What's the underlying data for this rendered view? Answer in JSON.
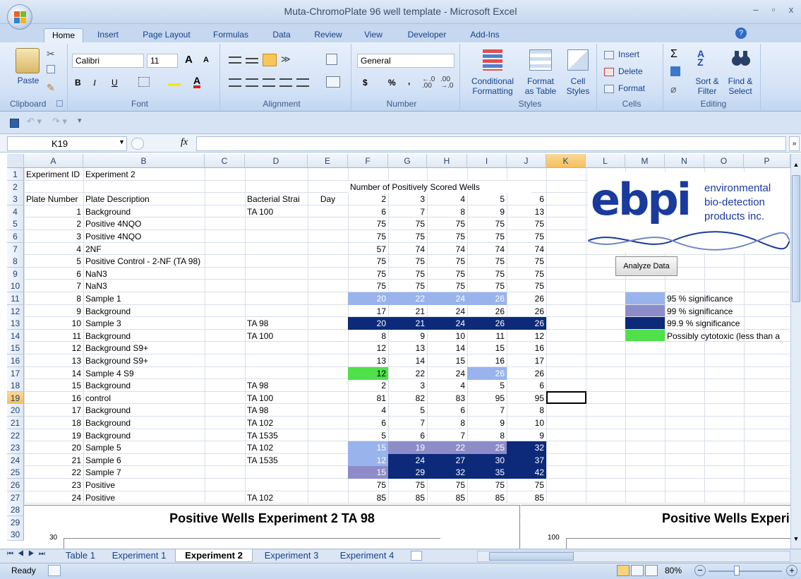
{
  "window": {
    "title": "Muta-ChromoPlate 96 well template - Microsoft Excel",
    "min": "–",
    "restore": "▫",
    "close": "x"
  },
  "tabs": [
    "Home",
    "Insert",
    "Page Layout",
    "Formulas",
    "Data",
    "Review",
    "View",
    "Developer",
    "Add-Ins"
  ],
  "ribbon": {
    "clipboard": {
      "paste": "Paste",
      "label": "Clipboard"
    },
    "font": {
      "name": "Calibri",
      "size": "11",
      "bold": "B",
      "italic": "I",
      "underline": "U",
      "grow": "A",
      "shrink": "A",
      "label": "Font"
    },
    "alignment": {
      "label": "Alignment"
    },
    "number": {
      "format": "General",
      "currency": "$",
      "percent": "%",
      "comma": ",",
      "label": "Number"
    },
    "styles": {
      "cond": "Conditional",
      "cond2": "Formatting",
      "fmt_table": "Format",
      "fmt_table2": "as Table",
      "cell_styles": "Cell",
      "cell_styles2": "Styles",
      "label": "Styles"
    },
    "cells": {
      "insert": "Insert",
      "delete": "Delete",
      "format": "Format",
      "label": "Cells"
    },
    "editing": {
      "sum": "Σ",
      "sort": "Sort &",
      "sort2": "Filter",
      "find": "Find &",
      "find2": "Select",
      "label": "Editing"
    }
  },
  "formula_bar": {
    "name_box": "K19",
    "fx": "fx",
    "value": ""
  },
  "columns": [
    "A",
    "B",
    "C",
    "D",
    "E",
    "F",
    "G",
    "H",
    "I",
    "J",
    "K",
    "L",
    "M",
    "N",
    "O",
    "P"
  ],
  "rows": [
    {
      "n": "1",
      "a": "Experiment ID",
      "b": "Experiment 2",
      "d": "",
      "e": "",
      "v": [
        "",
        "",
        "",
        "",
        ""
      ]
    },
    {
      "n": "2",
      "a": "",
      "b": "",
      "d": "",
      "e": "",
      "v": [
        "",
        "",
        "",
        "",
        ""
      ]
    },
    {
      "n": "3",
      "a": "Plate Number",
      "b": "Plate Description",
      "d": "Bacterial Strai",
      "e": "Day",
      "v": [
        "2",
        "3",
        "4",
        "5",
        "6"
      ]
    },
    {
      "n": "4",
      "a": "1",
      "b": "Background",
      "d": "TA 100",
      "e": "",
      "v": [
        "6",
        "7",
        "8",
        "9",
        "13"
      ]
    },
    {
      "n": "5",
      "a": "2",
      "b": "Positive 4NQO",
      "d": "",
      "e": "",
      "v": [
        "75",
        "75",
        "75",
        "75",
        "75"
      ]
    },
    {
      "n": "6",
      "a": "3",
      "b": "Positive 4NQO",
      "d": "",
      "e": "",
      "v": [
        "75",
        "75",
        "75",
        "75",
        "75"
      ]
    },
    {
      "n": "7",
      "a": "4",
      "b": "2NF",
      "d": "",
      "e": "",
      "v": [
        "57",
        "74",
        "74",
        "74",
        "74"
      ]
    },
    {
      "n": "8",
      "a": "5",
      "b": "Positive Control - 2-NF (TA 98)",
      "d": "",
      "e": "",
      "v": [
        "75",
        "75",
        "75",
        "75",
        "75"
      ]
    },
    {
      "n": "9",
      "a": "6",
      "b": "NaN3",
      "d": "",
      "e": "",
      "v": [
        "75",
        "75",
        "75",
        "75",
        "75"
      ]
    },
    {
      "n": "10",
      "a": "7",
      "b": "NaN3",
      "d": "",
      "e": "",
      "v": [
        "75",
        "75",
        "75",
        "75",
        "75"
      ]
    },
    {
      "n": "11",
      "a": "8",
      "b": "Sample 1",
      "d": "",
      "e": "",
      "v": [
        "20",
        "22",
        "24",
        "26",
        "26"
      ],
      "c": [
        "s95",
        "s95",
        "s95",
        "s95",
        ""
      ]
    },
    {
      "n": "12",
      "a": "9",
      "b": "Background",
      "d": "",
      "e": "",
      "v": [
        "17",
        "21",
        "24",
        "26",
        "26"
      ]
    },
    {
      "n": "13",
      "a": "10",
      "b": "Sample 3",
      "d": "TA 98",
      "e": "",
      "v": [
        "20",
        "21",
        "24",
        "26",
        "26"
      ],
      "c": [
        "s999",
        "s999",
        "s999",
        "s999",
        "s999"
      ]
    },
    {
      "n": "14",
      "a": "11",
      "b": "Background",
      "d": "TA 100",
      "e": "",
      "v": [
        "8",
        "9",
        "10",
        "11",
        "12"
      ]
    },
    {
      "n": "15",
      "a": "12",
      "b": "Background S9+",
      "d": "",
      "e": "",
      "v": [
        "12",
        "13",
        "14",
        "15",
        "16"
      ]
    },
    {
      "n": "16",
      "a": "13",
      "b": "Background S9+",
      "d": "",
      "e": "",
      "v": [
        "13",
        "14",
        "15",
        "16",
        "17"
      ]
    },
    {
      "n": "17",
      "a": "14",
      "b": "Sample 4 S9",
      "d": "",
      "e": "",
      "v": [
        "12",
        "22",
        "24",
        "26",
        "26"
      ],
      "c": [
        "tox",
        "",
        "",
        "s95",
        ""
      ]
    },
    {
      "n": "18",
      "a": "15",
      "b": "Background",
      "d": "TA 98",
      "e": "",
      "v": [
        "2",
        "3",
        "4",
        "5",
        "6"
      ]
    },
    {
      "n": "19",
      "a": "16",
      "b": "control",
      "d": "TA 100",
      "e": "",
      "v": [
        "81",
        "82",
        "83",
        "95",
        "95"
      ]
    },
    {
      "n": "20",
      "a": "17",
      "b": "Background",
      "d": "TA 98",
      "e": "",
      "v": [
        "4",
        "5",
        "6",
        "7",
        "8"
      ]
    },
    {
      "n": "21",
      "a": "18",
      "b": "Background",
      "d": "TA 102",
      "e": "",
      "v": [
        "6",
        "7",
        "8",
        "9",
        "10"
      ]
    },
    {
      "n": "22",
      "a": "19",
      "b": "Background",
      "d": "TA 1535",
      "e": "",
      "v": [
        "5",
        "6",
        "7",
        "8",
        "9"
      ]
    },
    {
      "n": "23",
      "a": "20",
      "b": "Sample 5",
      "d": "TA 102",
      "e": "",
      "v": [
        "15",
        "19",
        "22",
        "25",
        "32"
      ],
      "c": [
        "s95",
        "s99",
        "s99",
        "s99",
        "s999"
      ]
    },
    {
      "n": "24",
      "a": "21",
      "b": "Sample 6",
      "d": "TA 1535",
      "e": "",
      "v": [
        "12",
        "24",
        "27",
        "30",
        "37"
      ],
      "c": [
        "s95",
        "s999",
        "s999",
        "s999",
        "s999"
      ]
    },
    {
      "n": "25",
      "a": "22",
      "b": "Sample 7",
      "d": "",
      "e": "",
      "v": [
        "15",
        "29",
        "32",
        "35",
        "42"
      ],
      "c": [
        "s99",
        "s999",
        "s999",
        "s999",
        "s999"
      ]
    },
    {
      "n": "26",
      "a": "23",
      "b": "Positive",
      "d": "",
      "e": "",
      "v": [
        "75",
        "75",
        "75",
        "75",
        "75"
      ]
    },
    {
      "n": "27",
      "a": "24",
      "b": "Positive",
      "d": "TA 102",
      "e": "",
      "v": [
        "85",
        "85",
        "85",
        "85",
        "85"
      ]
    }
  ],
  "header_f2": "Number of Positively Scored Wells",
  "logo": {
    "mark": "ebpi",
    "line1": "environmental",
    "line2": "bio-detection",
    "line3": "products inc."
  },
  "analyze_button": "Analyze Data",
  "legend": [
    {
      "label": "95 % significance",
      "color": "#99b3ec"
    },
    {
      "label": "99 % significance",
      "color": "#8e8cc8"
    },
    {
      "label": "99.9 % significance",
      "color": "#0d2a7a"
    },
    {
      "label": "Possibly cytotoxic (less than a",
      "color": "#4fe04a"
    }
  ],
  "chart1": {
    "title": "Positive Wells Experiment 2 TA 98",
    "ytick": "30"
  },
  "chart2": {
    "title": "Positive Wells Experi",
    "ytick": "100"
  },
  "sheet_tabs": [
    "Table 1",
    "Experiment 1",
    "Experiment 2",
    "Experiment 3",
    "Experiment 4"
  ],
  "active_sheet": "Experiment 2",
  "status": {
    "ready": "Ready",
    "zoom": "80%"
  }
}
